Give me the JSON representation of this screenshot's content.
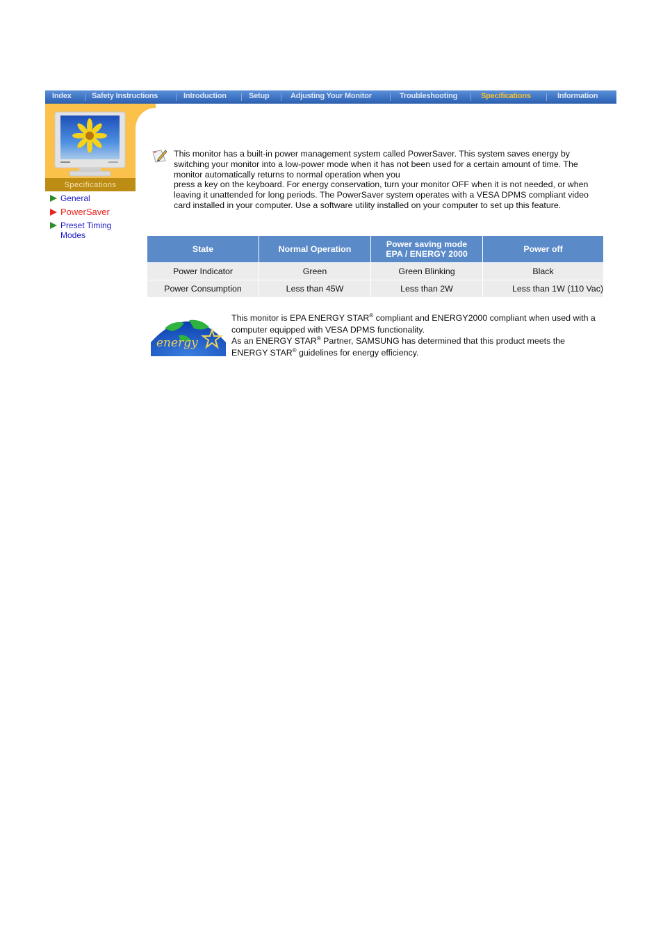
{
  "navbar": {
    "items": [
      {
        "label": "Index",
        "active": false
      },
      {
        "label": "Safety Instructions",
        "active": false
      },
      {
        "label": "Introduction",
        "active": false
      },
      {
        "label": "Setup",
        "active": false
      },
      {
        "label": "Adjusting Your Monitor",
        "active": false
      },
      {
        "label": "Troubleshooting",
        "active": false
      },
      {
        "label": "Specifications",
        "active": true
      },
      {
        "label": "Information",
        "active": false
      }
    ],
    "colors": {
      "bar": "#3f74c4",
      "text": "#dfe7f3",
      "active": "#f5c12e"
    }
  },
  "sidebar": {
    "section_label": "Specifications",
    "links": [
      {
        "label": "General",
        "active": false
      },
      {
        "label": "PowerSaver",
        "active": true
      },
      {
        "label": "Preset Timing Modes",
        "active": false
      }
    ]
  },
  "intro": {
    "icon": "note-pencil-icon",
    "lines": [
      "This monitor has a built-in power management system called PowerSaver. This system saves energy by switching your monitor into a low-power mode when it has not been used for a certain amount of time. The monitor automatically returns to normal operation when you",
      "press a key on the keyboard. For energy conservation, turn your monitor OFF when it is not needed, or when leaving it unattended for long periods. The PowerSaver system operates with a VESA DPMS compliant video card installed in your computer. Use a software utility installed on your computer to set up this feature."
    ]
  },
  "power_table": {
    "headers": [
      "State",
      "Normal Operation",
      "Power saving mode",
      "EPA / ENERGY 2000",
      "Power off"
    ],
    "rows": [
      [
        "Power Indicator",
        "Green",
        "Green Blinking",
        "Black"
      ],
      [
        "Power Consumption",
        "Less than 45W",
        "Less than 2W",
        "Less than 1W (110 Vac)"
      ]
    ]
  },
  "energy": {
    "logo": "energy-star-logo",
    "logo_text": "energy",
    "p1_a": "This monitor is EPA ENERGY STAR",
    "p1_b": " compliant and ENERGY2000 compliant when used with a computer equipped with VESA DPMS functionality.",
    "p2_a": "As an ENERGY STAR",
    "p2_b": " Partner, SAMSUNG has determined that this product meets the ENERGY STAR",
    "p2_c": " guidelines for energy efficiency.",
    "reg": "®"
  }
}
